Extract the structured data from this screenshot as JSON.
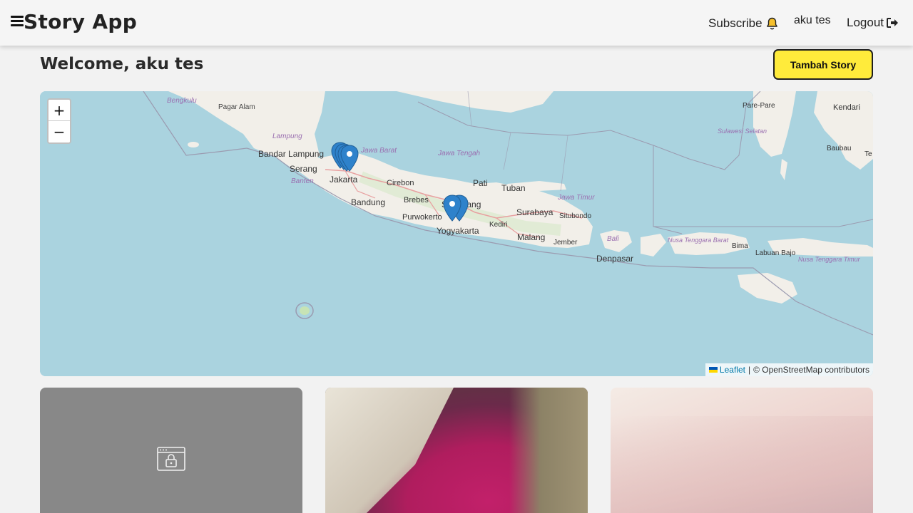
{
  "navbar": {
    "brand": "Story App",
    "subscribe_label": "Subscribe",
    "user_name": "aku tes",
    "logout_label": "Logout"
  },
  "header": {
    "welcome": "Welcome, aku tes",
    "add_story_label": "Tambah Story"
  },
  "map": {
    "zoom_in": "+",
    "zoom_out": "−",
    "attribution_link": "Leaflet",
    "attribution_separator": "|",
    "attribution_text": "© OpenStreetMap contributors",
    "labels": {
      "bengkulu": "Bengkulu",
      "pagar_alam": "Pagar Alam",
      "lampung": "Lampung",
      "bandar_lampung": "Bandar Lampung",
      "serang": "Serang",
      "banten": "Banten",
      "jakarta": "Jakarta",
      "jawa_barat": "Jawa Barat",
      "jawa_tengah": "Jawa Tengah",
      "cirebon": "Cirebon",
      "bandung": "Bandung",
      "brebes": "Brebes",
      "purwokerto": "Purwokerto",
      "semarang": "Semarang",
      "yogyakarta": "Yogyakarta",
      "pati": "Pati",
      "tuban": "Tuban",
      "surabaya": "Surabaya",
      "kediri": "Kediri",
      "malang": "Malang",
      "jawa_timur": "Jawa Timur",
      "situbondo": "Situbondo",
      "jember": "Jember",
      "bali": "Bali",
      "denpasar": "Denpasar",
      "ntb": "Nusa Tenggara Barat",
      "bima": "Bima",
      "labuan_bajo": "Labuan Bajo",
      "ntt": "Nusa Tenggara Timur",
      "parepare": "Pare-Pare",
      "kendari": "Kendari",
      "sulsel": "Sulawesi Selatan",
      "baubau": "Baubau",
      "te": "Te"
    }
  },
  "icons": {
    "menu": "hamburger-menu-icon",
    "bell": "bell-icon",
    "logout": "logout-icon",
    "marker": "map-marker-icon",
    "locked": "locked-window-icon"
  },
  "colors": {
    "primary_button": "#ffeb3b",
    "sea": "#aad3df",
    "land": "#f2efe9",
    "marker": "#2e82cb",
    "card_placeholder": "#888888"
  }
}
